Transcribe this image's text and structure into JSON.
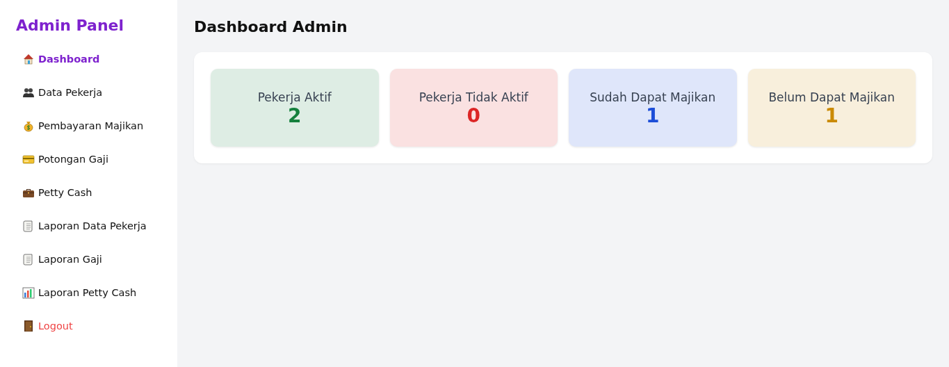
{
  "sidebar": {
    "title": "Admin Panel",
    "items": [
      {
        "label": "Dashboard",
        "kind": "nav",
        "selected": true
      },
      {
        "label": "Data Pekerja",
        "kind": "nav",
        "selected": false
      },
      {
        "label": "Pembayaran Majikan",
        "kind": "nav",
        "selected": false
      },
      {
        "label": "Potongan Gaji",
        "kind": "nav",
        "selected": false
      },
      {
        "label": "Petty Cash",
        "kind": "nav",
        "selected": false
      },
      {
        "label": "Laporan Data Pekerja",
        "kind": "nav",
        "selected": false
      },
      {
        "label": "Laporan Gaji",
        "kind": "nav",
        "selected": false
      },
      {
        "label": "Laporan Petty Cash",
        "kind": "nav",
        "selected": false
      },
      {
        "label": "Logout",
        "kind": "logout",
        "selected": false
      }
    ]
  },
  "main": {
    "title": "Dashboard Admin",
    "cards": [
      {
        "label": "Pekerja Aktif",
        "value": "2",
        "color": "#15803d"
      },
      {
        "label": "Pekerja Tidak Aktif",
        "value": "0",
        "color": "#dc2626"
      },
      {
        "label": "Sudah Dapat Majikan",
        "value": "1",
        "color": "#1d4ed8"
      },
      {
        "label": "Belum Dapat Majikan",
        "value": "1",
        "color": "#ca8a04"
      }
    ]
  }
}
